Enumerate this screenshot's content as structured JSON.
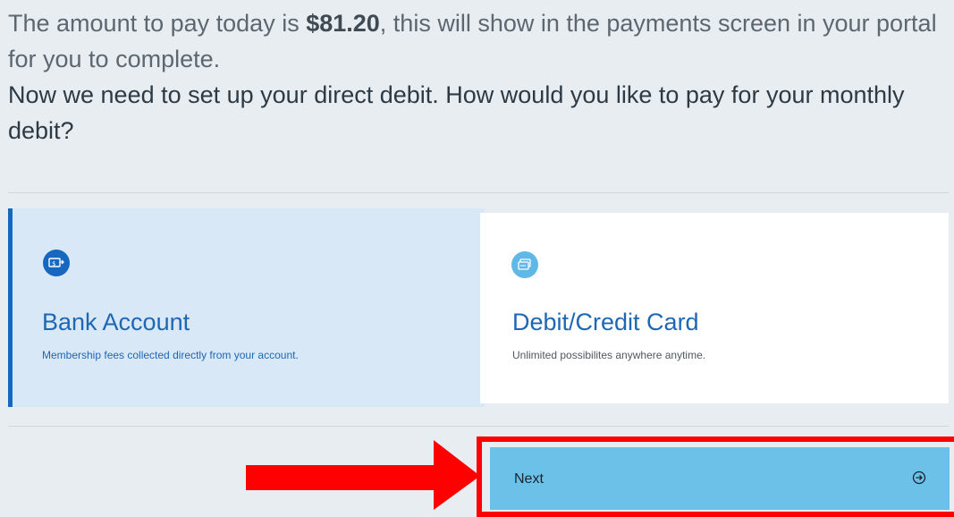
{
  "intro": {
    "text_before_amount": "The amount to pay today is ",
    "amount": "$81.20",
    "text_after_amount": ", this will show in the payments screen in your portal for you to complete.",
    "question": "Now we need to set up your direct debit. How would you like to pay for your monthly debit?"
  },
  "options": [
    {
      "title": "Bank Account",
      "description": "Membership fees collected directly from your account.",
      "icon": "bank-transfer-icon",
      "selected": true
    },
    {
      "title": "Debit/Credit Card",
      "description": "Unlimited possibilites anywhere anytime.",
      "icon": "credit-card-icon",
      "selected": false
    }
  ],
  "next_button": {
    "label": "Next",
    "icon": "arrow-right-circle-icon"
  },
  "colors": {
    "background": "#e8edf1",
    "accent": "#1567c0",
    "selected_card": "#d8e8f6",
    "next_button": "#6cc1e8",
    "highlight": "#ff0000"
  }
}
